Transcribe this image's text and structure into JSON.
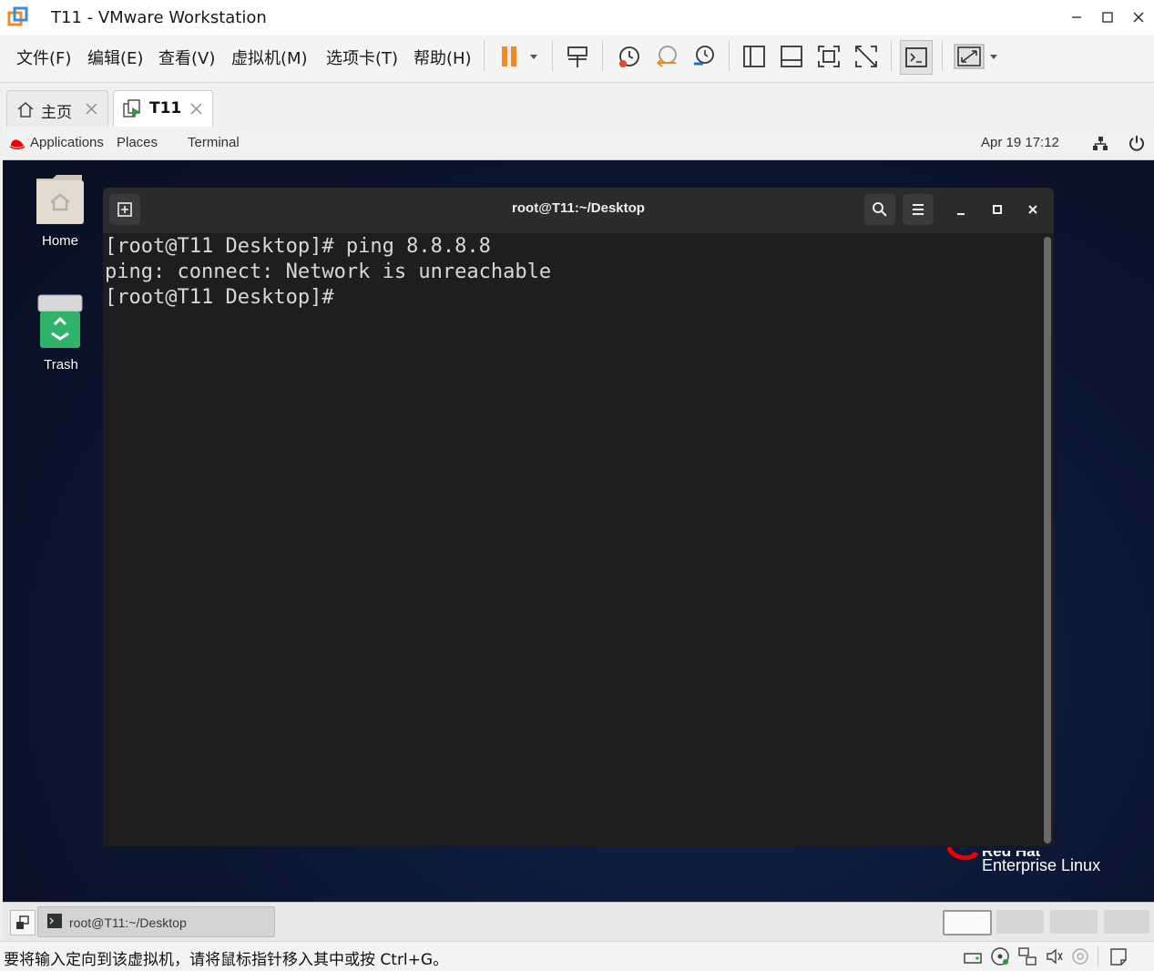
{
  "window": {
    "title": "T11 - VMware Workstation"
  },
  "menu": {
    "file": "文件(F)",
    "edit": "编辑(E)",
    "view": "查看(V)",
    "vm": "虚拟机(M)",
    "tabs": "选项卡(T)",
    "help": "帮助(H)"
  },
  "tabs": [
    {
      "label": "主页"
    },
    {
      "label": "T11"
    }
  ],
  "gnome": {
    "applications": "Applications",
    "places": "Places",
    "terminal": "Terminal",
    "datetime": "Apr 19  17:12"
  },
  "desktop": {
    "home_label": "Home",
    "trash_label": "Trash"
  },
  "terminal": {
    "title": "root@T11:~/Desktop",
    "lines": [
      "[root@T11 Desktop]# ping 8.8.8.8",
      "ping: connect: Network is unreachable",
      "[root@T11 Desktop]#"
    ]
  },
  "brand": {
    "name": "Red Hat",
    "product": "Enterprise Linux"
  },
  "taskbar": {
    "item": "root@T11:~/Desktop"
  },
  "statusbar": {
    "text": "要将输入定向到该虚拟机，请将鼠标指针移入其中或按 Ctrl+G。"
  },
  "colors": {
    "accent_orange": "#f08a24",
    "redhat_red": "#ee0000",
    "terminal_bg": "#1e1e1e"
  }
}
